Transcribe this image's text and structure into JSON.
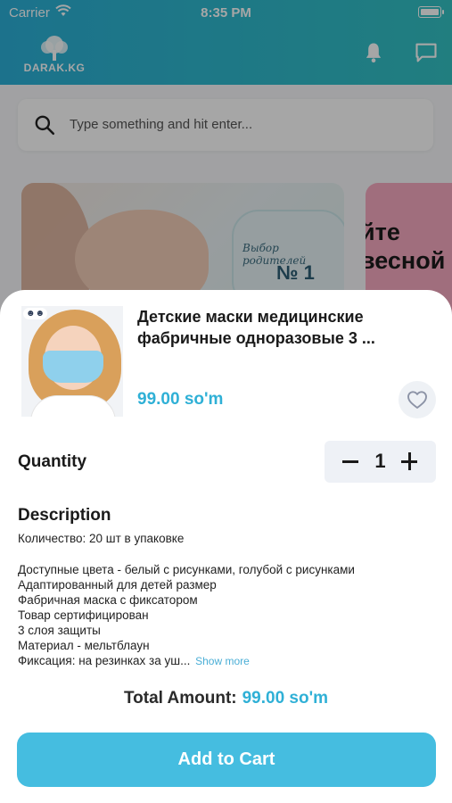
{
  "status_bar": {
    "carrier": "Carrier",
    "time": "8:35 PM"
  },
  "header": {
    "logo_text": "DARAK.KG",
    "icons": [
      "bell-icon",
      "chat-icon"
    ]
  },
  "search": {
    "placeholder": "Type something and hit enter..."
  },
  "banners": {
    "first": {
      "text_line": "Выбор родителей",
      "number": "№ 1"
    },
    "second": {
      "lines": [
        "йте",
        "весной"
      ]
    }
  },
  "product": {
    "title": "Детские маски медицинские фабричные одноразовые 3 ...",
    "price": "99.00 so'm",
    "favorite_icon": "heart-outline-icon"
  },
  "quantity": {
    "label": "Quantity",
    "value": "1"
  },
  "description": {
    "title": "Description",
    "first_line": "Количество: 20 шт в упаковке",
    "lines": [
      "Доступные цвета - белый с рисунками, голубой с рисунками",
      "Адаптированный для детей размер",
      "Фабричная маска с фиксатором",
      "Товар сертифицирован",
      "3 слоя защиты",
      "Материал - мельтблаун",
      "Фиксация: на резинках за уш..."
    ],
    "show_more": "Show more"
  },
  "total": {
    "label": "Total Amount:",
    "value": "99.00 so'm"
  },
  "actions": {
    "add_to_cart": "Add to Cart"
  },
  "colors": {
    "accent": "#2fb0d6",
    "button": "#45bde0",
    "header_start": "#2bb0d8",
    "header_end": "#33c2c4"
  }
}
